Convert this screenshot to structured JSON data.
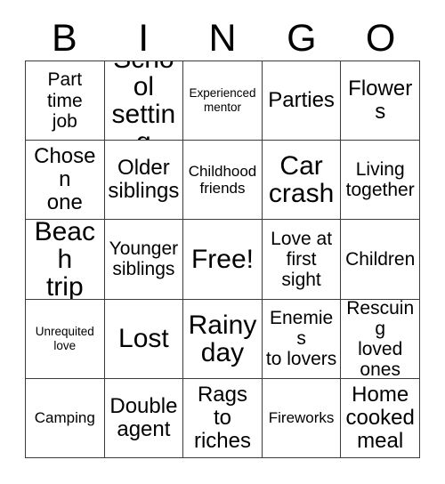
{
  "card": {
    "header_letters": [
      "B",
      "I",
      "N",
      "G",
      "O"
    ],
    "columns": 5,
    "rows": 5,
    "border_color": "#3b3b3b",
    "background_color": "#ffffff",
    "text_color": "#000000",
    "cells": [
      [
        {
          "label": "Part\ntime\njob",
          "size": "m"
        },
        {
          "label": "School\nsetting",
          "size": "xl"
        },
        {
          "label": "Experienced\nmentor",
          "size": "xs"
        },
        {
          "label": "Parties",
          "size": "l"
        },
        {
          "label": "Flowers",
          "size": "l"
        }
      ],
      [
        {
          "label": "Chosen\none",
          "size": "l"
        },
        {
          "label": "Older\nsiblings",
          "size": "l"
        },
        {
          "label": "Childhood\nfriends",
          "size": "s"
        },
        {
          "label": "Car\ncrash",
          "size": "xl"
        },
        {
          "label": "Living\ntogether",
          "size": "m"
        }
      ],
      [
        {
          "label": "Beach\ntrip",
          "size": "xl"
        },
        {
          "label": "Younger\nsiblings",
          "size": "m"
        },
        {
          "label": "Free!",
          "size": "xl"
        },
        {
          "label": "Love at\nfirst\nsight",
          "size": "m"
        },
        {
          "label": "Children",
          "size": "m"
        }
      ],
      [
        {
          "label": "Unrequited\nlove",
          "size": "xs"
        },
        {
          "label": "Lost",
          "size": "xl"
        },
        {
          "label": "Rainy\nday",
          "size": "xl"
        },
        {
          "label": "Enemies\nto lovers",
          "size": "m"
        },
        {
          "label": "Rescuing\nloved\nones",
          "size": "m"
        }
      ],
      [
        {
          "label": "Camping",
          "size": "s"
        },
        {
          "label": "Double\nagent",
          "size": "l"
        },
        {
          "label": "Rags\nto\nriches",
          "size": "l"
        },
        {
          "label": "Fireworks",
          "size": "s"
        },
        {
          "label": "Home\ncooked\nmeal",
          "size": "l"
        }
      ]
    ]
  }
}
